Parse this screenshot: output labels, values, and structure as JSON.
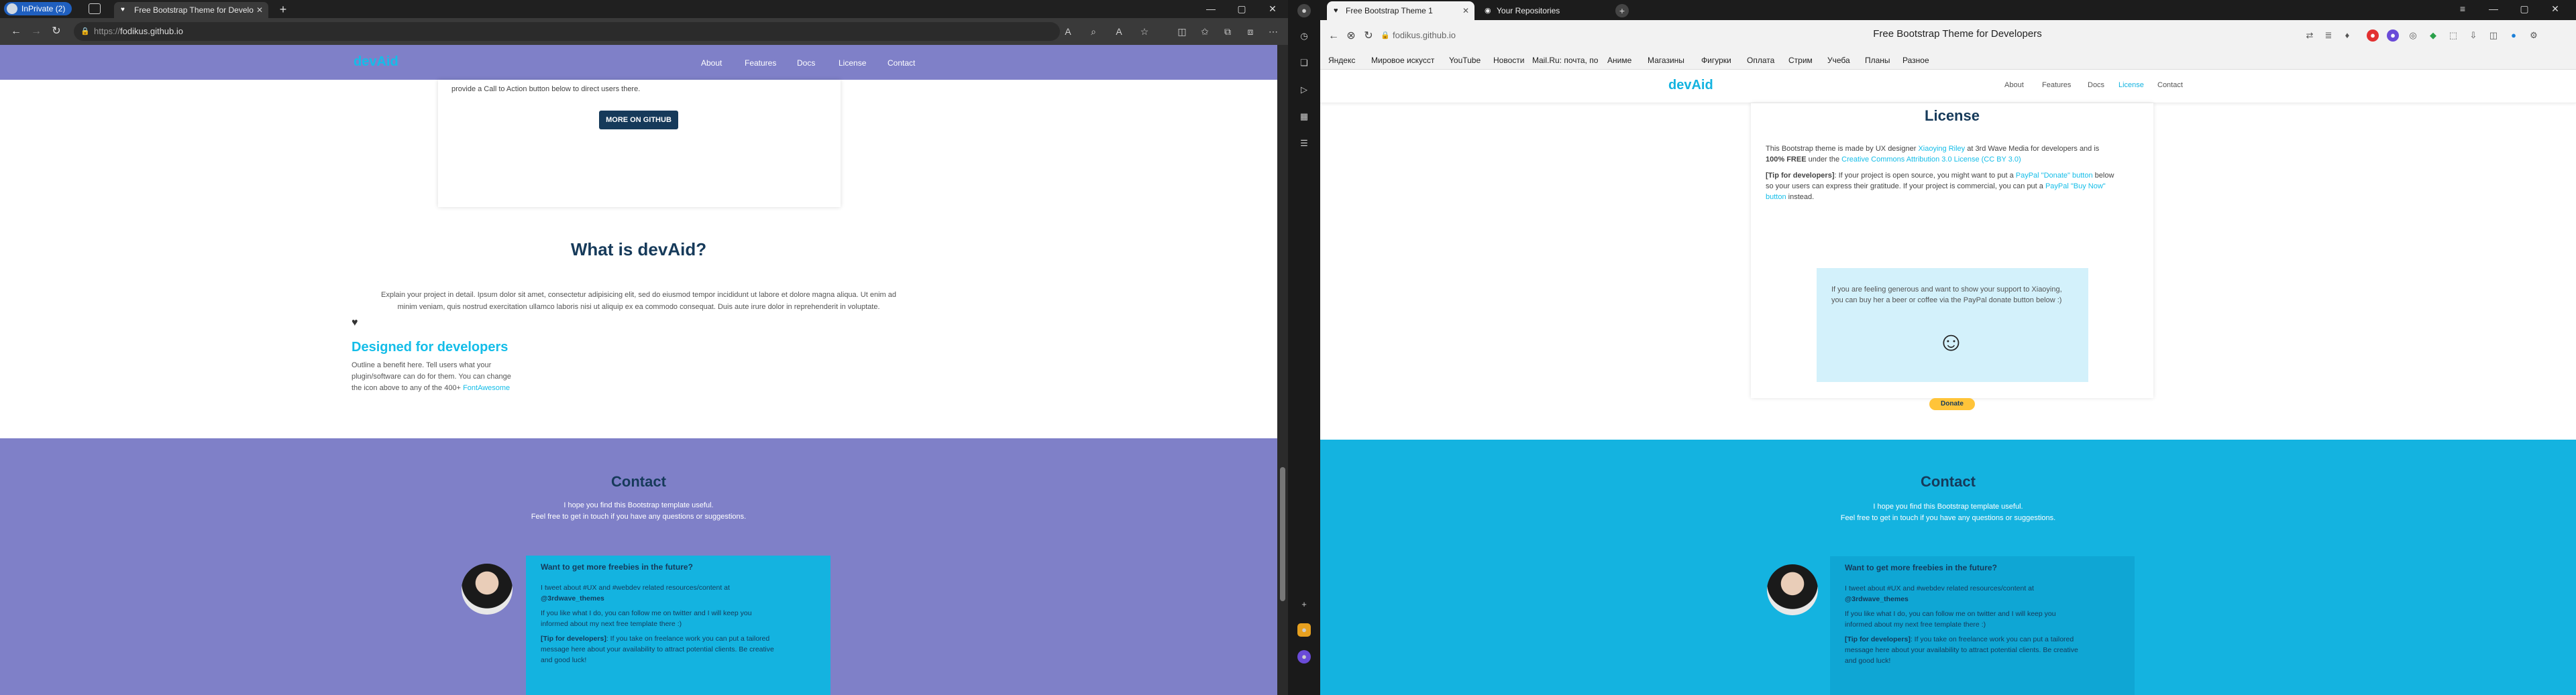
{
  "left_browser": {
    "inprivate_label": "InPrivate (2)",
    "tab_title": "Free Bootstrap Theme for Develo",
    "url_prefix": "https://",
    "url_host": "fodikus.github.io",
    "page": {
      "nav": {
        "brand": "devAid",
        "links": [
          "About",
          "Features",
          "Docs",
          "License",
          "Contact"
        ]
      },
      "top_card_text": "provide a Call to Action button below to direct users there.",
      "cta_button": "MORE ON GITHUB",
      "what_heading": "What is devAid?",
      "what_para_1": "Explain your project in detail. Ipsum dolor sit amet, consectetur adipisicing elit, sed do eiusmod tempor incididunt ut labore et dolore magna aliqua. Ut enim ad",
      "what_para_2": "minim veniam, quis nostrud exercitation ullamco laboris nisi ut aliquip ex ea commodo consequat. Duis aute irure dolor in reprehenderit in voluptate.",
      "feature_heading": "Designed for developers",
      "feature_line_1": "Outline a benefit here. Tell users what your",
      "feature_line_2": "plugin/software can do for them. You can change",
      "feature_line_3": "the icon above to any of the 400+",
      "feature_link": "FontAwesome",
      "contact": {
        "heading": "Contact",
        "sub_1": "I hope you find this Bootstrap template useful.",
        "sub_2": "Feel free to get in touch if you have any questions or suggestions.",
        "box_title": "Want to get more freebies in the future?",
        "tweet": "I tweet about #UX and #webdev related resources/content at",
        "handle": "@3rdwave_themes",
        "follow_1": "If you like what I do, you can follow me on twitter and I will keep you",
        "follow_2": "informed about my next free template there :)",
        "tip_label": "[Tip for developers]",
        "tip_1": ": If you take on freelance work you can put a tailored",
        "tip_2": "message here about your availability to attract potential clients. Be creative",
        "tip_3": "and good luck!"
      }
    }
  },
  "right_browser": {
    "tabs": [
      {
        "title": "Free Bootstrap Theme 1",
        "active": true
      },
      {
        "title": "Your Repositories",
        "active": false
      }
    ],
    "url": "fodikus.github.io",
    "window_title": "Free Bootstrap Theme for Developers",
    "bookmarks": [
      "Яндекс",
      "Мировое искусст",
      "YouTube",
      "Новости",
      "Mail.Ru: почта, по",
      "Аниме",
      "Магазины",
      "Фигурки",
      "Оплата",
      "Стрим",
      "Учеба",
      "Планы",
      "Разное"
    ],
    "page": {
      "nav": {
        "brand": "devAid",
        "links": [
          "About",
          "Features",
          "Docs",
          "License",
          "Contact"
        ],
        "active": "License"
      },
      "license_heading": "License",
      "lic_1a": "This Bootstrap theme is made by UX designer ",
      "lic_1_link": "Xiaoying Riley",
      "lic_1b": " at 3rd Wave Media for developers and is",
      "lic_2a": "100% FREE",
      "lic_2b": " under the ",
      "lic_2_link": "Creative Commons Attribution 3.0 License (CC BY 3.0)",
      "tip_label": "[Tip for developers]",
      "tip_a": ": If your project is open source, you might want to put a ",
      "tip_link1": "PayPal \"Donate\" button",
      "tip_b": " below",
      "tip_c": "so your users can express their gratitude. If your project is commercial, you can put a ",
      "tip_link2": "PayPal \"Buy Now\"",
      "tip_link3": "button",
      "tip_d": " instead.",
      "donate_text": "If you are feeling generous and want to show your support to Xiaoying, you can buy her a beer or coffee via the PayPal donate button below :)",
      "donate_button": "Donate",
      "contact": {
        "heading": "Contact",
        "sub_1": "I hope you find this Bootstrap template useful.",
        "sub_2": "Feel free to get in touch if you have any questions or suggestions.",
        "box_title": "Want to get more freebies in the future?",
        "tweet": "I tweet about #UX and #webdev related resources/content at",
        "handle": "@3rdwave_themes",
        "follow_1": "If you like what I do, you can follow me on twitter and I will keep you",
        "follow_2": "informed about my next free template there :)",
        "tip_label": "[Tip for developers]",
        "tip_1": ": If you take on freelance work you can put a tailored",
        "tip_2": "message here about your availability to attract potential clients. Be creative",
        "tip_3": "and good luck!"
      }
    }
  },
  "colors": {
    "purple": "#7f80c8",
    "cyan": "#14b3e0",
    "navy": "#163a5a",
    "edge_blue": "#1f5fbf"
  },
  "icons": [
    "inprivate-avatar-icon",
    "back-icon",
    "forward-icon",
    "reload-icon",
    "lock-icon",
    "heart-icon",
    "smiley-icon",
    "github-icon",
    "settings-icon"
  ]
}
